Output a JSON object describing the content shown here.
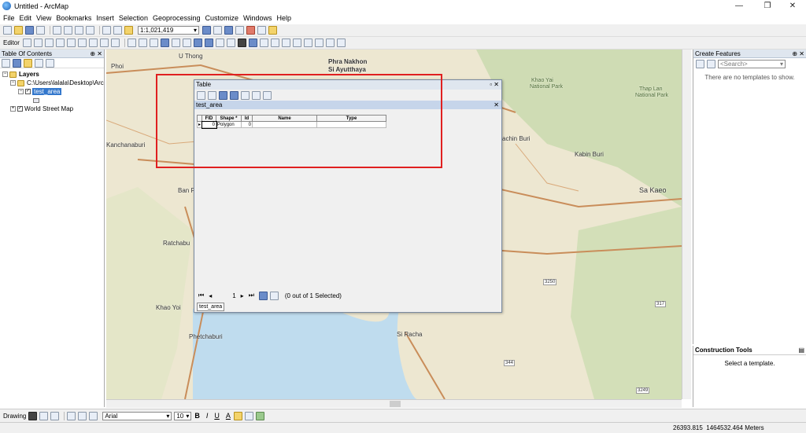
{
  "window": {
    "title": "Untitled - ArcMap",
    "minimize": "—",
    "maximize": "❐",
    "close": "✕"
  },
  "menu": [
    "File",
    "Edit",
    "View",
    "Bookmarks",
    "Insert",
    "Selection",
    "Geoprocessing",
    "Customize",
    "Windows",
    "Help"
  ],
  "toolbar": {
    "scale": "1:1,021,419",
    "editor_label": "Editor"
  },
  "toc": {
    "title": "Table Of Contents",
    "layers_label": "Layers",
    "folder_path": "C:\\Users\\lalala\\Desktop\\Arc",
    "layer1": "test_area",
    "layer2": "World Street Map"
  },
  "map_labels": [
    {
      "text": "Phoi",
      "cls": "l1"
    },
    {
      "text": "U Thong",
      "cls": "l2"
    },
    {
      "text": "Phra Nakhon",
      "cls": "l3"
    },
    {
      "text": "Si Ayutthaya",
      "cls": "l4"
    },
    {
      "text": "Khao Yai",
      "cls": "l5"
    },
    {
      "text": "National Park",
      "cls": "l6"
    },
    {
      "text": "Thap Lan",
      "cls": "l7"
    },
    {
      "text": "National Park",
      "cls": "l8"
    },
    {
      "text": "Kanchanaburi",
      "cls": "l9"
    },
    {
      "text": "achin Buri",
      "cls": "l10"
    },
    {
      "text": "Kabin Buri",
      "cls": "l11"
    },
    {
      "text": "Sa Kaeo",
      "cls": "l12"
    },
    {
      "text": "Ban P",
      "cls": "l13"
    },
    {
      "text": "Ratchabu",
      "cls": "l14"
    },
    {
      "text": "Khao Yoi",
      "cls": "l15"
    },
    {
      "text": "Phetchaburi",
      "cls": "l16"
    },
    {
      "text": "Si Racha",
      "cls": "l17"
    },
    {
      "text": "3250",
      "cls": "l18"
    },
    {
      "text": "317",
      "cls": "l19"
    },
    {
      "text": "344",
      "cls": "l20"
    },
    {
      "text": "3249",
      "cls": "l21"
    }
  ],
  "table_window": {
    "title": "Table",
    "table_name": "test_area",
    "columns": [
      "FID",
      "Shape *",
      "Id",
      "Name",
      "Type"
    ],
    "rows": [
      [
        "0",
        "Polygon",
        "0",
        "",
        ""
      ]
    ],
    "record": "1",
    "selection_status": "(0 out of 1 Selected)",
    "tab_label": "test_area"
  },
  "create_features": {
    "title": "Create Features",
    "search_placeholder": "<Search>",
    "message": "There are no templates to show."
  },
  "construction_tools": {
    "title": "Construction Tools",
    "message": "Select a template."
  },
  "drawing": {
    "label": "Drawing",
    "font": "Arial",
    "size": "10",
    "bold": "B",
    "italic": "I",
    "underline": "U",
    "font_color": "A"
  },
  "status": {
    "coords": "26393.815  1464532.464 Meters"
  },
  "colors": {
    "highlight": "#e02020",
    "selection": "#3377cc"
  }
}
